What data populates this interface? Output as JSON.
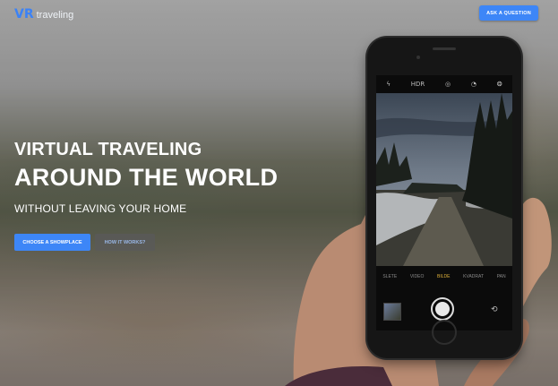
{
  "header": {
    "logo_mark": "VR",
    "logo_text": "traveling",
    "ask_button": "ASK A QUESTION"
  },
  "hero": {
    "line1": "VIRTUAL TRAVELING",
    "line2": "AROUND THE WORLD",
    "line3": "WITHOUT LEAVING YOUR HOME",
    "primary_button": "CHOOSE A SHOWPLACE",
    "secondary_button": "HOW IT WORKS?"
  },
  "camera": {
    "top_icons": [
      "flash-icon",
      "hdr-icon",
      "live-icon",
      "timer-icon",
      "filters-icon"
    ],
    "hdr_label": "HDR",
    "modes": [
      "SLETE",
      "VIDEO",
      "BILDE",
      "KVADRAT",
      "PAN"
    ],
    "active_mode": "BILDE"
  },
  "colors": {
    "accent": "#3d86f7",
    "secondary_button_bg": "#5a5a5a",
    "active_mode": "#e0b23a"
  }
}
